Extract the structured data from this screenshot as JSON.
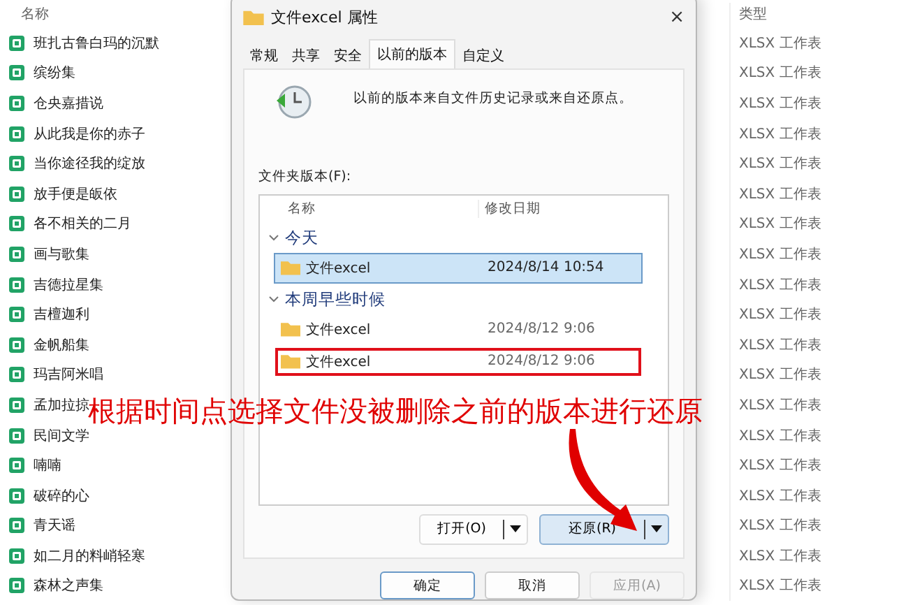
{
  "explorer": {
    "columns": [
      "名称",
      "类型"
    ],
    "rows": [
      {
        "name": "班扎古鲁白玛的沉默",
        "type": "XLSX 工作表"
      },
      {
        "name": "缤纷集",
        "type": "XLSX 工作表"
      },
      {
        "name": "仓央嘉措说",
        "type": "XLSX 工作表"
      },
      {
        "name": "从此我是你的赤子",
        "type": "XLSX 工作表"
      },
      {
        "name": "当你途径我的绽放",
        "type": "XLSX 工作表"
      },
      {
        "name": "放手便是皈依",
        "type": "XLSX 工作表"
      },
      {
        "name": "各不相关的二月",
        "type": "XLSX 工作表"
      },
      {
        "name": "画与歌集",
        "type": "XLSX 工作表"
      },
      {
        "name": "吉德拉星集",
        "type": "XLSX 工作表"
      },
      {
        "name": "吉檀迦利",
        "type": "XLSX 工作表"
      },
      {
        "name": "金帆船集",
        "type": "XLSX 工作表"
      },
      {
        "name": "玛吉阿米唱",
        "type": "XLSX 工作表"
      },
      {
        "name": "孟加拉掠",
        "type": "XLSX 工作表"
      },
      {
        "name": "民间文学",
        "type": "XLSX 工作表"
      },
      {
        "name": "喃喃",
        "type": "XLSX 工作表"
      },
      {
        "name": "破碎的心",
        "type": "XLSX 工作表"
      },
      {
        "name": "青天谣",
        "type": "XLSX 工作表"
      },
      {
        "name": "如二月的料峭轻寒",
        "type": "XLSX 工作表"
      },
      {
        "name": "森林之声集",
        "type": "XLSX 工作表"
      }
    ]
  },
  "dialog": {
    "title": "文件excel 属性",
    "close": "×",
    "tabs": [
      {
        "label": "常规",
        "selected": false
      },
      {
        "label": "共享",
        "selected": false
      },
      {
        "label": "安全",
        "selected": false
      },
      {
        "label": "以前的版本",
        "selected": true
      },
      {
        "label": "自定义",
        "selected": false
      }
    ],
    "description": "以前的版本来自文件历史记录或来自还原点。",
    "list_label": "文件夹版本(F):",
    "list": {
      "columns": [
        "名称",
        "修改日期"
      ],
      "groups": [
        {
          "label": "今天",
          "expanded": true,
          "items": [
            {
              "name": "文件excel",
              "date": "2024/8/14 10:54",
              "selected": true,
              "highlighted": false
            }
          ]
        },
        {
          "label": "本周早些时候",
          "expanded": true,
          "items": [
            {
              "name": "文件excel",
              "date": "2024/8/12 9:06",
              "selected": false,
              "highlighted": false
            },
            {
              "name": "文件excel",
              "date": "2024/8/12 9:06",
              "selected": false,
              "highlighted": true
            }
          ]
        }
      ]
    },
    "action_buttons": [
      {
        "label": "打开(O)",
        "kind": "plain"
      },
      {
        "label": "还原(R)",
        "kind": "accent"
      }
    ],
    "footer_buttons": [
      {
        "label": "确定",
        "disabled": false,
        "default": true
      },
      {
        "label": "取消",
        "disabled": false,
        "default": false
      },
      {
        "label": "应用(A)",
        "disabled": true,
        "default": false
      }
    ]
  },
  "annotation": {
    "text": "根据时间点选择文件没被删除之前的版本进行还原"
  }
}
